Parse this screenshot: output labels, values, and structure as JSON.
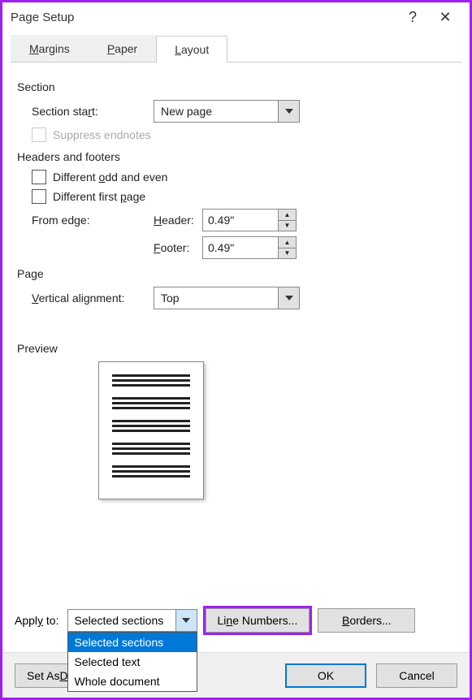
{
  "title": "Page Setup",
  "tabs": {
    "margins": "Margins",
    "paper": "Paper",
    "layout": "Layout"
  },
  "section": {
    "header": "Section",
    "start_label": "Section start:",
    "start_value": "New page",
    "suppress": "Suppress endnotes"
  },
  "hf": {
    "header": "Headers and footers",
    "odd_even": "Different odd and even",
    "first_page": "Different first page",
    "from_edge": "From edge:",
    "header_label": "Header:",
    "header_value": "0.49\"",
    "footer_label": "Footer:",
    "footer_value": "0.49\""
  },
  "page": {
    "header": "Page",
    "valign_label": "Vertical alignment:",
    "valign_value": "Top"
  },
  "preview": {
    "header": "Preview"
  },
  "apply": {
    "label": "Apply to:",
    "value": "Selected sections",
    "options": [
      "Selected sections",
      "Selected text",
      "Whole document"
    ]
  },
  "buttons": {
    "line_numbers": "Line Numbers...",
    "borders": "Borders...",
    "set_default": "Set As Default",
    "ok": "OK",
    "cancel": "Cancel"
  }
}
